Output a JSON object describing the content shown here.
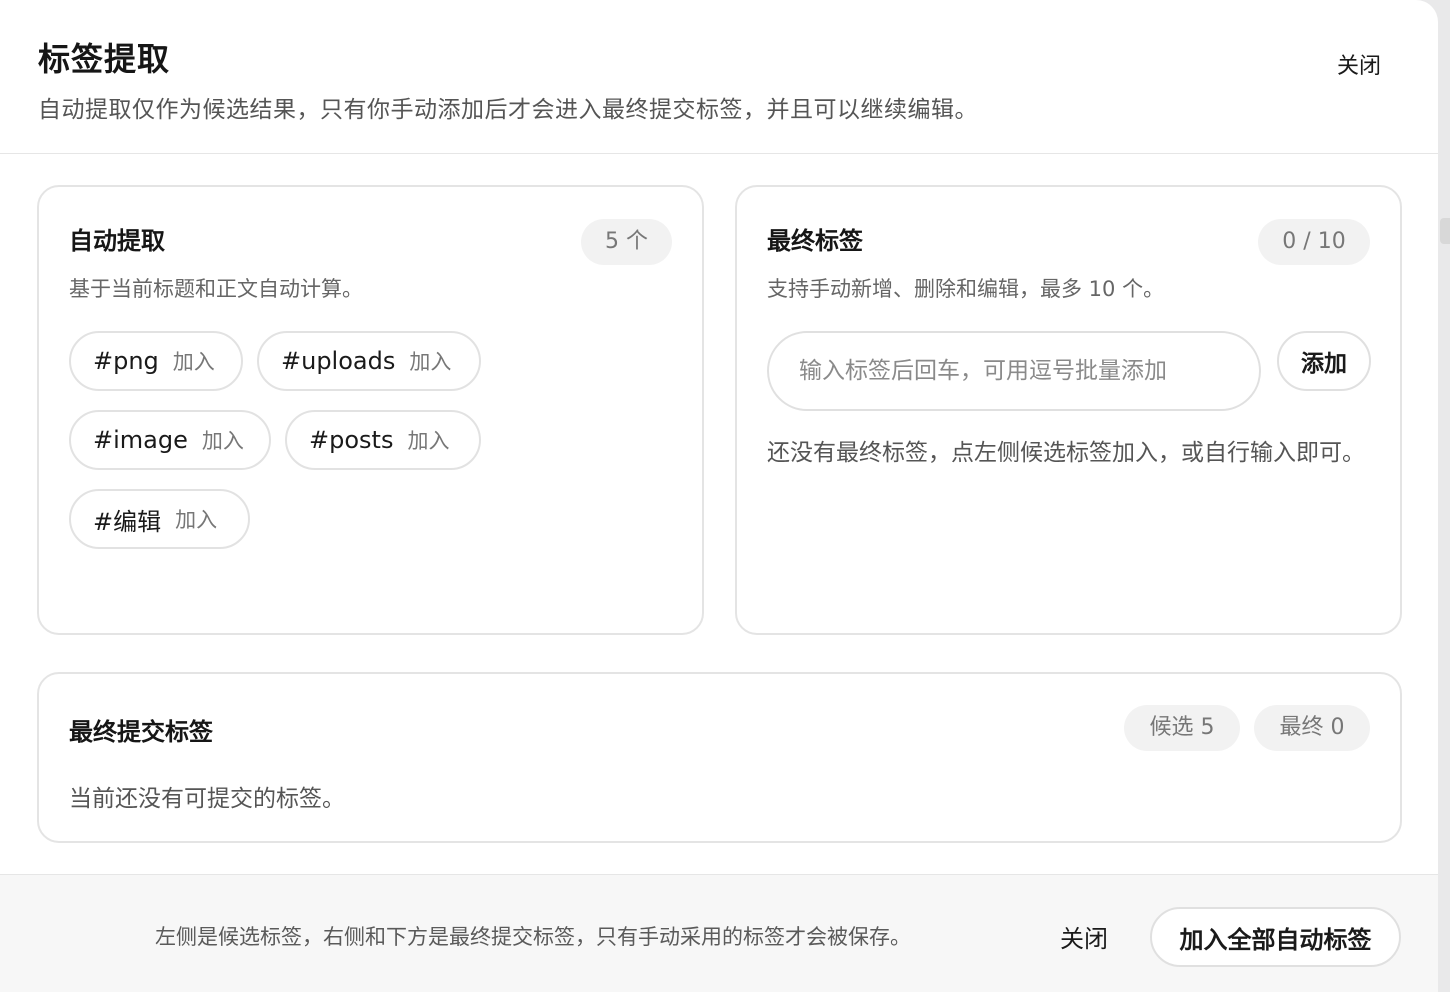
{
  "header": {
    "title": "标签提取",
    "subtitle": "自动提取仅作为候选结果，只有你手动添加后才会进入最终提交标签，并且可以继续编辑。",
    "close_label": "关闭"
  },
  "auto_extract": {
    "title": "自动提取",
    "description": "基于当前标题和正文自动计算。",
    "count_badge": "5 个",
    "chips": [
      {
        "tag": "#png",
        "action": "加入"
      },
      {
        "tag": "#uploads",
        "action": "加入"
      },
      {
        "tag": "#image",
        "action": "加入"
      },
      {
        "tag": "#posts",
        "action": "加入"
      },
      {
        "tag": "#编辑",
        "action": "加入"
      }
    ]
  },
  "final_tags": {
    "title": "最终标签",
    "description": "支持手动新增、删除和编辑，最多 10 个。",
    "count_badge": "0 / 10",
    "input_placeholder": "输入标签后回车，可用逗号批量添加",
    "input_value": "",
    "add_label": "添加",
    "empty_text": "还没有最终标签，点左侧候选标签加入，或自行输入即可。"
  },
  "submit_tags": {
    "title": "最终提交标签",
    "empty_text": "当前还没有可提交的标签。",
    "candidate_badge": "候选 5",
    "final_badge": "最终 0"
  },
  "footer": {
    "note": "左侧是候选标签，右侧和下方是最终提交标签，只有手动采用的标签才会被保存。",
    "close_label": "关闭",
    "add_all_label": "加入全部自动标签"
  }
}
